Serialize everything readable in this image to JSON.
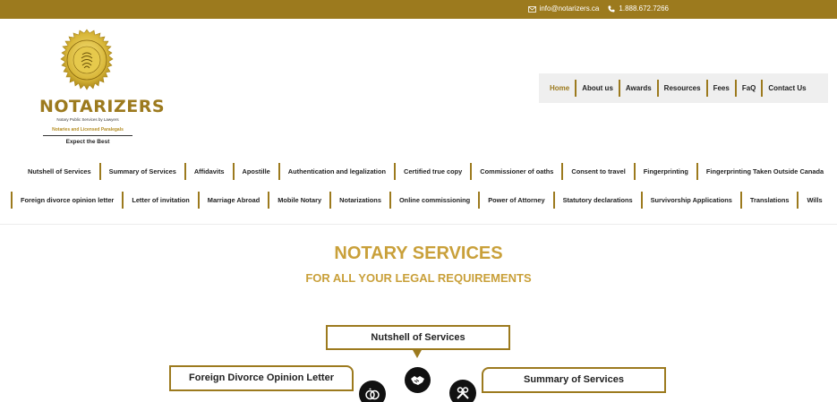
{
  "topbar": {
    "email": "info@notarizers.ca",
    "phone": "1.888.672.7266",
    "email_icon": "envelope-icon",
    "phone_icon": "phone-icon",
    "bg_color": "#9c7a1e"
  },
  "logo": {
    "name": "NOTARIZERS",
    "tagline1": "Notary Public Services by Lawyers",
    "tagline2": "Notaries and Licensed Paralegals",
    "tagline3": "Expect the Best"
  },
  "main_nav": {
    "items": [
      {
        "label": "Home",
        "active": true
      },
      {
        "label": "About us",
        "active": false
      },
      {
        "label": "Awards",
        "active": false
      },
      {
        "label": "Resources",
        "active": false
      },
      {
        "label": "Fees",
        "active": false
      },
      {
        "label": "FaQ",
        "active": false
      },
      {
        "label": "Contact Us",
        "active": false
      }
    ]
  },
  "services_nav": {
    "row1": [
      "Nutshell of Services",
      "Summary of Services",
      "Affidavits",
      "Apostille",
      "Authentication and legalization",
      "Certified true copy",
      "Commissioner of oaths",
      "Consent to travel",
      "Fingerprinting",
      "Fingerprinting Taken Outside Canada"
    ],
    "row2": [
      "Foreign divorce opinion letter",
      "Letter of invitation",
      "Marriage Abroad",
      "Mobile Notary",
      "Notarizations",
      "Online commissioning",
      "Power of Attorney",
      "Statutory declarations",
      "Survivorship Applications",
      "Translations",
      "Wills"
    ]
  },
  "hero": {
    "title": "NOTARY SERVICES",
    "subtitle": "FOR ALL YOUR LEGAL REQUIREMENTS"
  },
  "diagram": {
    "center_box": "Nutshell of Services",
    "left_box": "Foreign Divorce Opinion Letter",
    "right_box": "Summary of Services",
    "icons": [
      "handshake-icon",
      "rings-icon",
      "tools-icon"
    ]
  },
  "colors": {
    "gold": "#9c7a1e",
    "title_gold": "#c9a03a"
  }
}
